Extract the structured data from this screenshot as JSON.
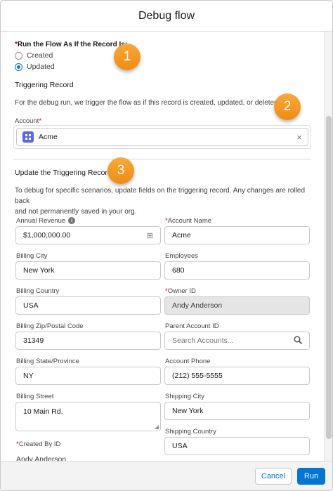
{
  "header": {
    "title": "Debug flow"
  },
  "run_as": {
    "label": "Run the Flow As If the Record Is:",
    "required_mark": "*",
    "options": [
      {
        "label": "Created",
        "checked": false
      },
      {
        "label": "Updated",
        "checked": true
      }
    ]
  },
  "callouts": [
    "1",
    "2",
    "3"
  ],
  "triggering_record": {
    "title": "Triggering Record",
    "description": "For the debug run, we trigger the flow as if this record is created, updated, or deleted.",
    "account_label": "Account",
    "account_required_mark": "*",
    "account_value": "Acme",
    "clear_glyph": "×"
  },
  "update_section": {
    "title": "Update the Triggering Record",
    "description_line1": "To debug for specific scenarios, update fields on the triggering record. Any changes are rolled back",
    "description_line2": "and not permanently saved in your org."
  },
  "fields": {
    "annual_revenue": {
      "label": "Annual Revenue",
      "value": "$1,000,000.00",
      "info_glyph": "i",
      "calc_glyph": "⊞"
    },
    "account_name": {
      "label": "Account Name",
      "required_mark": "*",
      "value": "Acme"
    },
    "billing_city": {
      "label": "Billing City",
      "value": "New York"
    },
    "employees": {
      "label": "Employees",
      "value": "680"
    },
    "billing_country": {
      "label": "Billing Country",
      "value": "USA"
    },
    "owner_id": {
      "label": "Owner ID",
      "required_mark": "*",
      "value": "Andy Anderson"
    },
    "billing_zip": {
      "label": "Billing Zip/Postal Code",
      "value": "31349"
    },
    "parent_account": {
      "label": "Parent Account ID",
      "placeholder": "Search Accounts..."
    },
    "billing_state": {
      "label": "Billing State/Province",
      "value": "NY"
    },
    "account_phone": {
      "label": "Account Phone",
      "value": "(212) 555-5555"
    },
    "billing_street": {
      "label": "Billing Street",
      "value": "10 Main Rd."
    },
    "shipping_city": {
      "label": "Shipping City",
      "value": "New York"
    },
    "shipping_country": {
      "label": "Shipping Country",
      "value": "USA"
    },
    "created_by": {
      "label": "Created By ID",
      "required_mark": "*",
      "value": "Andy Anderson"
    }
  },
  "footer": {
    "cancel_label": "Cancel",
    "run_label": "Run"
  },
  "colors": {
    "brand": "#0176d3",
    "callout": "#ef8c12",
    "required": "#ba0517",
    "account_icon": "#5867e8"
  }
}
